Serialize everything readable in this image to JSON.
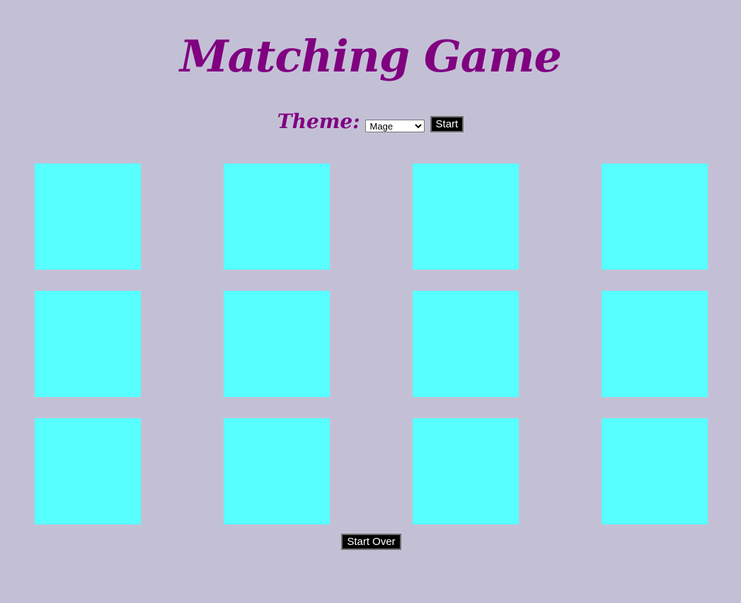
{
  "title": "Matching Game",
  "theme": {
    "label": "Theme:",
    "selected": "Mage"
  },
  "start_label": "Start",
  "start_over_label": "Start Over",
  "board": {
    "rows": 3,
    "columns": 4,
    "card_color": "#57ffff",
    "face_down_cards": 12
  },
  "colors": {
    "background": "#c3c0d6",
    "title": "#800080",
    "button_background": "#000000",
    "button_text": "#ffffff"
  }
}
